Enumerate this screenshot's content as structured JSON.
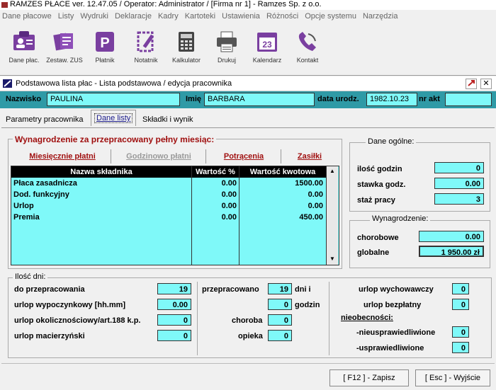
{
  "app": {
    "title": "RAMZES PŁACE ver. 12.47.05 /   Operator: Administrator /   [Firma nr 1] - Ramzes Sp. z o.o."
  },
  "menu": [
    "Dane płacowe",
    "Listy",
    "Wydruki",
    "Deklaracje",
    "Kadry",
    "Kartoteki",
    "Ustawienia",
    "Różności",
    "Opcje systemu",
    "Narzędzia"
  ],
  "toolbar": [
    {
      "label": "Dane płac.",
      "icon": "id-card-icon"
    },
    {
      "label": "Zestaw. ZUS",
      "icon": "documents-icon"
    },
    {
      "label": "Płatnik",
      "icon": "platnik-p-icon"
    },
    {
      "label": "Notatnik",
      "icon": "notepad-icon"
    },
    {
      "label": "Kalkulator",
      "icon": "calculator-icon"
    },
    {
      "label": "Drukuj",
      "icon": "printer-icon"
    },
    {
      "label": "Kalendarz",
      "icon": "calendar-icon"
    },
    {
      "label": "Kontakt",
      "icon": "phone-icon"
    }
  ],
  "calendar_day": "23",
  "window": {
    "title": "Podstawowa lista płac - Lista podstawowa / edycja pracownika"
  },
  "employee": {
    "surname_label": "Nazwisko",
    "surname": "PAULINA",
    "name_label": "Imię",
    "name": "BARBARA",
    "dob_label": "data urodz.",
    "dob": "1982.10.23",
    "nr_akt_label": "nr akt",
    "nr_akt": ""
  },
  "tabs": [
    "Parametry pracownika",
    "Dane listy",
    "Składki i wynik"
  ],
  "wages": {
    "title": "Wynagrodzenie za przepracowany pełny miesiąc:",
    "subtabs": [
      "Miesięcznie płatni",
      "Godzinowo płatni",
      "Potrącenia",
      "Zasiłki"
    ],
    "columns": [
      "Nazwa składnika",
      "Wartość %",
      "Wartość kwotowa"
    ],
    "rows": [
      {
        "name": "Płaca zasadnicza",
        "pct": "0.00",
        "amount": "1500.00"
      },
      {
        "name": "Dod. funkcyjny",
        "pct": "0.00",
        "amount": "0.00"
      },
      {
        "name": "Urlop",
        "pct": "0.00",
        "amount": "0.00"
      },
      {
        "name": "Premia",
        "pct": "0.00",
        "amount": "450.00"
      }
    ]
  },
  "general": {
    "title": "Dane ogólne:",
    "hours_label": "ilość godzin",
    "hours": "0",
    "rate_label": "stawka godz.",
    "rate": "0.00",
    "seniority_label": "staż pracy",
    "seniority": "3"
  },
  "salary": {
    "title": "Wynagrodzenie:",
    "sick_label": "chorobowe",
    "sick": "0.00",
    "total_label": "globalne",
    "total": "1 950.00 zł"
  },
  "days": {
    "title": "Ilość dni:",
    "to_work_label": "do przepracowania",
    "to_work": "19",
    "vacation_label": "urlop wypoczynkowy [hh.mm]",
    "vacation": "0.00",
    "occasional_label": "urlop okolicznościowy/art.188 k.p.",
    "occasional": "0",
    "maternity_label": "urlop macierzyński",
    "maternity": "0",
    "worked_label": "przepracowano",
    "worked_days": "19",
    "days_i_label": "dni i",
    "worked_hours": "0",
    "hours_label": "godzin",
    "sickness_label": "choroba",
    "sickness": "0",
    "care_label": "opieka",
    "care": "0",
    "parental_label": "urlop wychowawczy",
    "parental": "0",
    "unpaid_label": "urlop bezpłatny",
    "unpaid": "0",
    "absences_label": "nieobecności:",
    "unexcused_label": "-nieusprawiedliwione",
    "unexcused": "0",
    "excused_label": "-usprawiedliwione",
    "excused": "0"
  },
  "buttons": {
    "save": "[ F12 ] - Zapisz",
    "exit": "[ Esc ] - Wyjście"
  }
}
